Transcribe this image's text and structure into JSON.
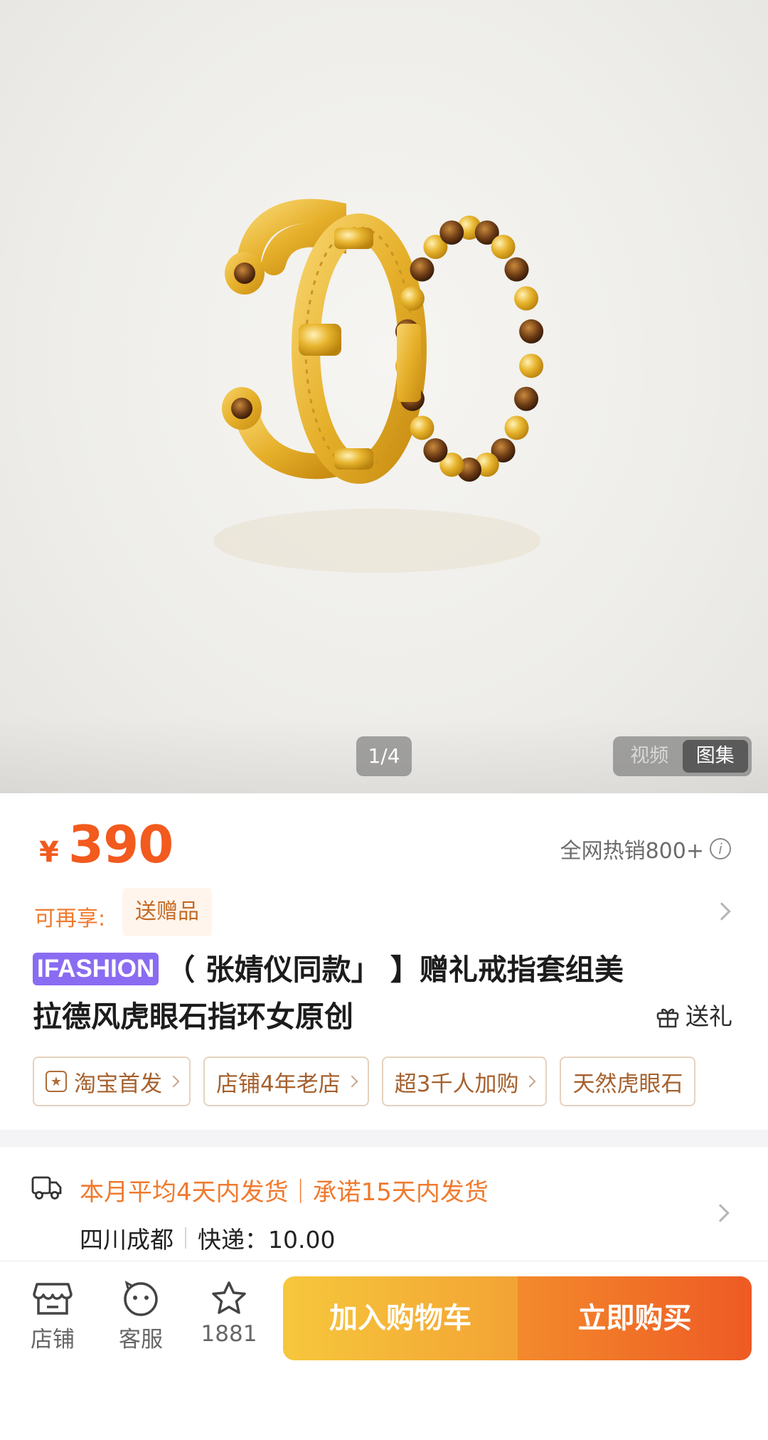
{
  "gallery": {
    "page_indicator": "1/4",
    "media_tabs": [
      {
        "label": "视频",
        "active": false
      },
      {
        "label": "图集",
        "active": true
      }
    ]
  },
  "price": {
    "currency": "¥",
    "value": "390",
    "sales": "全网热销800+"
  },
  "benefit": {
    "label": "可再享:",
    "chip": "送赠品"
  },
  "title": {
    "brand": "IFASHION",
    "line1": "（    张婧仪同款」  】赠礼戒指套组美",
    "line2": "拉德风虎眼石指环女原创",
    "gift_label": "送礼"
  },
  "tags": [
    {
      "label": "淘宝首发",
      "icon": "star-badge-icon"
    },
    {
      "label": "店铺4年老店"
    },
    {
      "label": "超3千人加购"
    },
    {
      "label": "天然虎眼石"
    }
  ],
  "shipping": {
    "line1": "本月平均4天内发货｜承诺15天内发货",
    "origin": "四川成都",
    "express": "快递：10.00"
  },
  "bottom_bar": {
    "store_label": "店铺",
    "service_label": "客服",
    "favorite_count": "1881",
    "cart_label": "加入购物车",
    "buy_label": "立即购买"
  },
  "colors": {
    "price": "#f25a1e",
    "accent": "#f07a2e",
    "brand_tag": "#8a6cf2",
    "cart_button": "#f6c73c",
    "buy_button": "#ee5a24"
  }
}
